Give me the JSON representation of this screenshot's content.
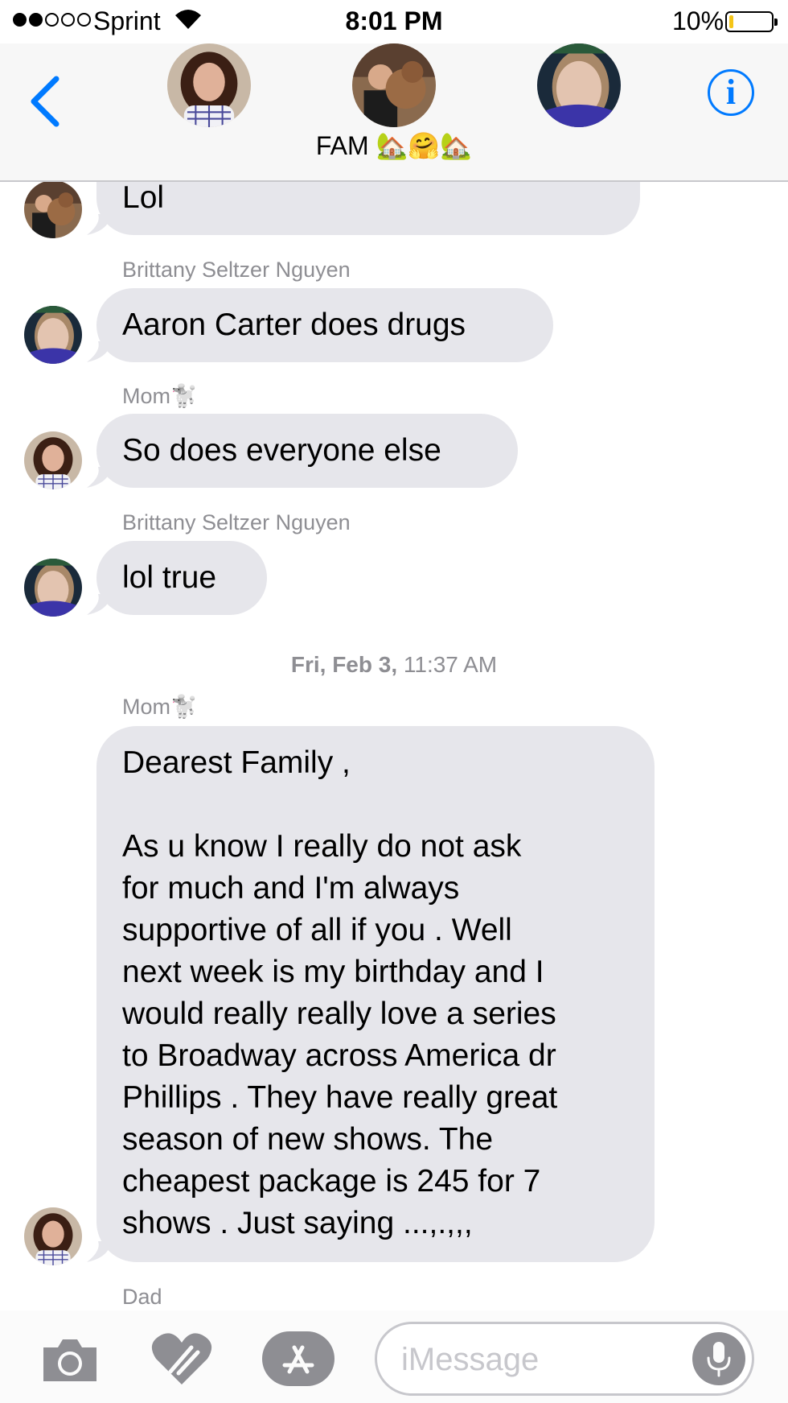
{
  "status_bar": {
    "carrier": "Sprint",
    "time": "8:01 PM",
    "battery_percent": "10%",
    "battery_level": 0.1,
    "signal_bars_full": 2,
    "signal_bars_total": 5
  },
  "header": {
    "group_name": "FAM 🏡🤗🏡",
    "participants": [
      "mom-avatar",
      "dad-avatar",
      "brittany-avatar"
    ],
    "accent_color": "#007aff"
  },
  "messages": [
    {
      "sender": "",
      "text": "Lol"
    },
    {
      "sender": "Brittany Seltzer Nguyen",
      "text": "Aaron Carter does drugs"
    },
    {
      "sender": "Mom🐩",
      "text": "So does everyone else"
    },
    {
      "sender": "Brittany Seltzer Nguyen",
      "text": "lol true"
    }
  ],
  "timestamp": {
    "day": "Fri, Feb 3,",
    "time": "11:37 AM"
  },
  "long_message": {
    "sender": "Mom🐩",
    "greeting": "Dearest Family ,",
    "lines": [
      "As u know I really do not ask",
      "for much and I'm always",
      "supportive of all if you . Well",
      "next week is my birthday and I",
      "would really really love a series",
      "to Broadway across America dr",
      "Phillips . They have really great",
      "season of new shows. The",
      "cheapest package is 245 for 7",
      "shows . Just saying ...,.,,,"
    ]
  },
  "next_sender": "Dad",
  "compose": {
    "placeholder": "iMessage",
    "icons": [
      "camera-icon",
      "digital-touch-icon",
      "app-store-icon",
      "microphone-icon"
    ]
  },
  "colors": {
    "bubble_gray": "#e6e6eb",
    "secondary_text": "#8e8e93",
    "battery_yellow": "#f5c518"
  }
}
